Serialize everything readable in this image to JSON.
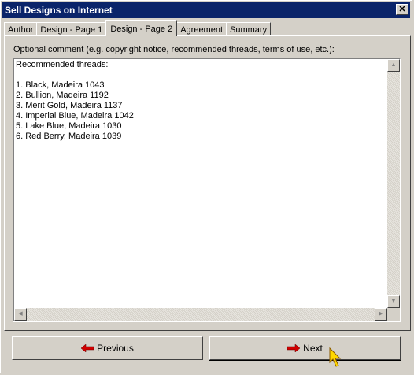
{
  "window": {
    "title": "Sell Designs on Internet",
    "close_symbol": "✕"
  },
  "tabs": [
    {
      "label": "Author",
      "active": false
    },
    {
      "label": "Design - Page 1",
      "active": false
    },
    {
      "label": "Design - Page 2",
      "active": true
    },
    {
      "label": "Agreement",
      "active": false
    },
    {
      "label": "Summary",
      "active": false
    }
  ],
  "comment": {
    "label": "Optional comment (e.g. copyright notice, recommended threads, terms of use, etc.):",
    "text": "Recommended threads:\n\n1. Black, Madeira 1043\n2. Bullion, Madeira 1192\n3. Merit Gold, Madeira 1137\n4. Imperial Blue, Madeira 1042\n5. Lake Blue, Madeira 1030\n6. Red Berry, Madeira 1039"
  },
  "buttons": {
    "previous_label": "Previous",
    "next_label": "Next"
  },
  "icons": {
    "previous": "left-arrow-icon",
    "next": "right-arrow-icon",
    "cursor": "mouse-pointer-icon",
    "arrow_color": "#d00000",
    "cursor_color": "#ffd700"
  }
}
